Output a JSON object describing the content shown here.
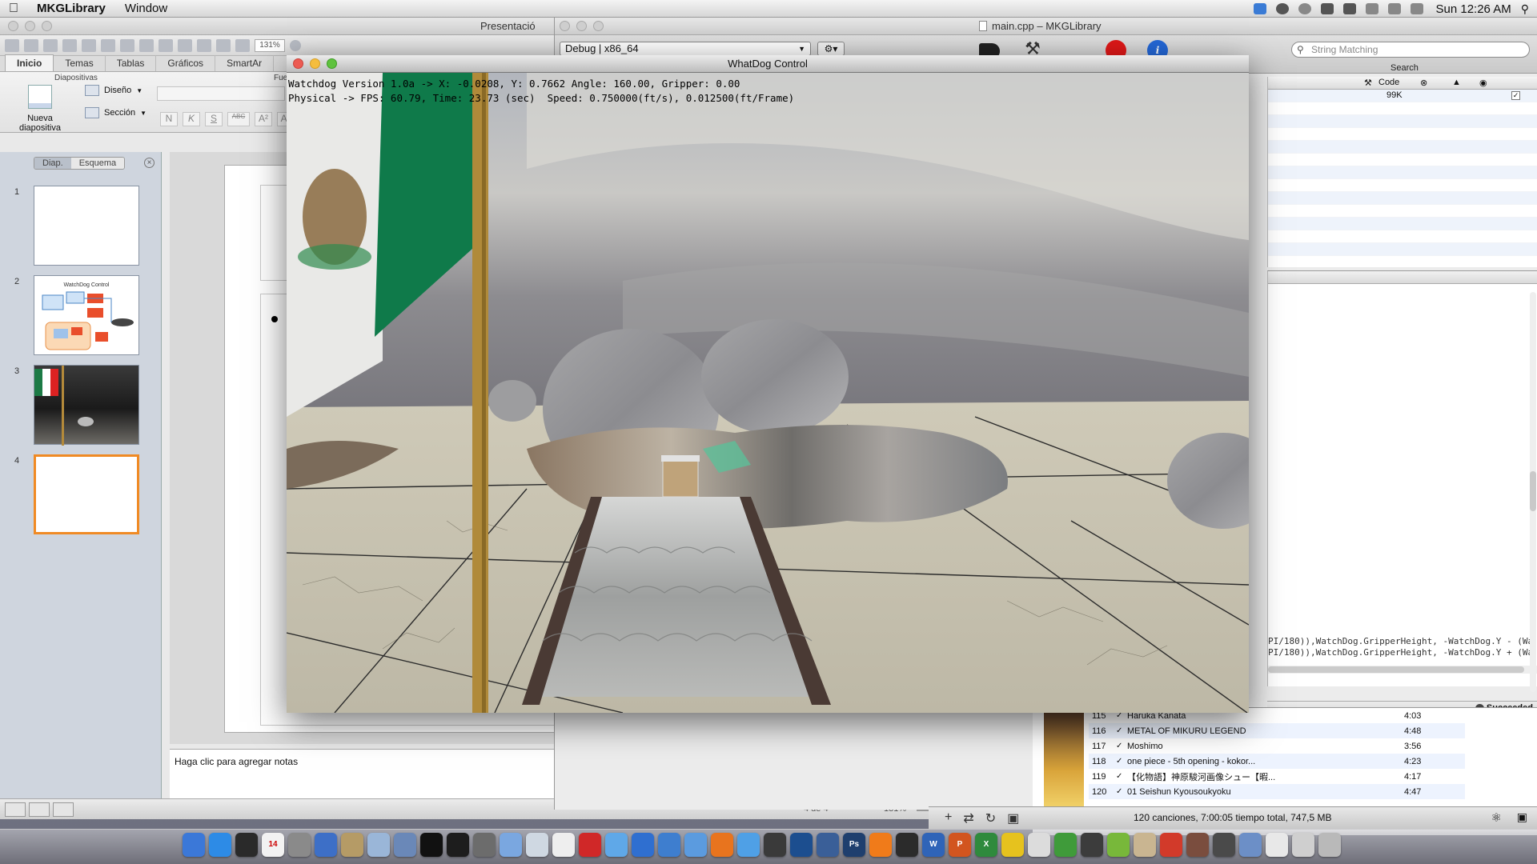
{
  "menubar": {
    "app_name": "MKGLibrary",
    "items": [
      "Window"
    ],
    "clock": "Sun 12:26 AM"
  },
  "powerpoint": {
    "window_title": "Presentació",
    "zoom_box": "131%",
    "tabs": [
      "Inicio",
      "Temas",
      "Tablas",
      "Gráficos",
      "SmartAr"
    ],
    "group_title": "Diapositivas",
    "partial_group": "Fue",
    "new_slide_label": "Nueva diapositiva",
    "layout_label": "Diseño",
    "section_label": "Sección",
    "format_buttons": [
      "N",
      "K",
      "S",
      "ABC",
      "A²",
      "A₂"
    ],
    "pane_tabs": [
      "Diap.",
      "Esquema"
    ],
    "slides": [
      {
        "num": "1",
        "title": ""
      },
      {
        "num": "2",
        "title": "WatchDog Control"
      },
      {
        "num": "3",
        "title": ""
      },
      {
        "num": "4",
        "title": ""
      }
    ],
    "notes_placeholder": "Haga clic para agregar notas",
    "slide_counter": "4 de 4",
    "zoom_level": "131%"
  },
  "xcode": {
    "window_title": "main.cpp – MKGLibrary",
    "scheme": "Debug | x86_64",
    "search_placeholder": "String Matching",
    "search_label": "Search",
    "table_header": [
      "Code"
    ],
    "table_value": "99K",
    "code_lines": [
      "PI/180)),WatchDog.GripperHeight, -WatchDog.Y - (Wa",
      "PI/180)),WatchDog.GripperHeight, -WatchDog.Y + (Wa"
    ],
    "build_status": "Succeeded"
  },
  "itunes": {
    "tracks": [
      {
        "num": "115",
        "name": "Haruka Kanata",
        "time": "4:03"
      },
      {
        "num": "116",
        "name": "METAL OF MIKURU LEGEND",
        "time": "4:48"
      },
      {
        "num": "117",
        "name": "Moshimo",
        "time": "3:56"
      },
      {
        "num": "118",
        "name": "one piece - 5th opening - kokor...",
        "time": "4:23"
      },
      {
        "num": "119",
        "name": "【化物語】神原駿河画像シュー【暇...",
        "time": "4:17"
      },
      {
        "num": "120",
        "name": "01 Seishun Kyousoukyoku",
        "time": "4:47"
      }
    ],
    "summary": "120 canciones, 7:00:05 tiempo total, 747,5 MB"
  },
  "whatdog": {
    "window_title": "WhatDog Control",
    "hud_line1": "Watchdog Version 1.0a -> X: -0.0208, Y: 0.7662 Angle: 160.00, Gripper: 0.00",
    "hud_line2": "Physical -> FPS: 60.79, Time: 23.73 (sec)  Speed: 0.750000(ft/s), 0.012500(ft/Frame)"
  },
  "dock": {
    "icons": [
      {
        "name": "finder-icon",
        "color": "#3b78d8"
      },
      {
        "name": "app-store-icon",
        "color": "#2d8be6"
      },
      {
        "name": "dashboard-icon",
        "color": "#2a2a2a"
      },
      {
        "name": "calendar-icon",
        "color": "#f2f2f2",
        "label": "14"
      },
      {
        "name": "system-preferences-icon",
        "color": "#8a8a8a"
      },
      {
        "name": "xcode-icon",
        "color": "#3d6fc7"
      },
      {
        "name": "instruments-icon",
        "color": "#b59b66"
      },
      {
        "name": "cube-icon",
        "color": "#9ab6d8"
      },
      {
        "name": "network-icon",
        "color": "#6a88b8"
      },
      {
        "name": "terminal-icon",
        "color": "#111111"
      },
      {
        "name": "activity-monitor-icon",
        "color": "#1d1d1d"
      },
      {
        "name": "utility-icon",
        "color": "#6c6c6c"
      },
      {
        "name": "moon-icon",
        "color": "#7aa7e0"
      },
      {
        "name": "box-icon",
        "color": "#cfd8e2"
      },
      {
        "name": "textedit-icon",
        "color": "#eeeeee"
      },
      {
        "name": "flashcard-icon",
        "color": "#d02828"
      },
      {
        "name": "droplet-icon",
        "color": "#5fa8e8"
      },
      {
        "name": "itunes-icon",
        "color": "#2f6fd0"
      },
      {
        "name": "preview-icon",
        "color": "#3e7ecf"
      },
      {
        "name": "adium-icon",
        "color": "#5b9bdf"
      },
      {
        "name": "firefox-icon",
        "color": "#e8741e"
      },
      {
        "name": "safari-icon",
        "color": "#4fa0e6"
      },
      {
        "name": "comic-icon",
        "color": "#3a3a3a"
      },
      {
        "name": "quicktime-icon",
        "color": "#1c4e8f"
      },
      {
        "name": "iphoto-icon",
        "color": "#3a5f98"
      },
      {
        "name": "photoshop-icon",
        "color": "#1f3f6e",
        "label": "Ps"
      },
      {
        "name": "blender-icon",
        "color": "#f07b1a"
      },
      {
        "name": "unity-icon",
        "color": "#2b2b2b"
      },
      {
        "name": "word-icon",
        "color": "#2f64b8",
        "label": "W"
      },
      {
        "name": "powerpoint-icon",
        "color": "#d2551f",
        "label": "P"
      },
      {
        "name": "excel-icon",
        "color": "#2f8a3d",
        "label": "X"
      },
      {
        "name": "chrome-icon",
        "color": "#e6c21e"
      },
      {
        "name": "clock-icon",
        "color": "#dcdcdc"
      },
      {
        "name": "utorrent-icon",
        "color": "#3f9b3a"
      },
      {
        "name": "steam-icon",
        "color": "#3c3c3c"
      },
      {
        "name": "serial-icon",
        "color": "#78b83a"
      },
      {
        "name": "mail-icon",
        "color": "#c9b591"
      },
      {
        "name": "feather-icon",
        "color": "#d23a2a"
      },
      {
        "name": "photo-booth-icon",
        "color": "#7a4d3e"
      },
      {
        "name": "keyboard-icon",
        "color": "#4a4a4a"
      },
      {
        "name": "folder-icon",
        "color": "#6c8fc7"
      },
      {
        "name": "documents-icon",
        "color": "#e8e8e8"
      },
      {
        "name": "downloads-icon",
        "color": "#cfcfcf"
      },
      {
        "name": "trash-icon",
        "color": "#b9b9b9"
      }
    ]
  }
}
